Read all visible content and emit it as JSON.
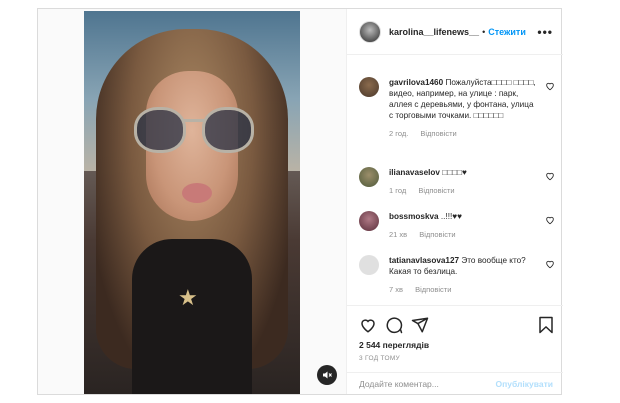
{
  "post": {
    "author": {
      "username": "karolina__lifenews__",
      "follow_label": "Стежити",
      "separator": "•",
      "more_glyph": "•••"
    },
    "comments": [
      {
        "username": "gavrilova1460",
        "text": "Пожалуйста□□□□ □□□□, видео, например, на улице : парк, аллея с деревьями, у фонтана, улица с торговыми точками. □□□□□□",
        "time": "2 год.",
        "reply_label": "Відповісти"
      },
      {
        "username": "ilianavaselov",
        "text": "□□□□♥",
        "time": "1 год",
        "reply_label": "Відповісти"
      },
      {
        "username": "bossmoskva",
        "text": "..!!!♥♥",
        "time": "21 хв",
        "reply_label": "Відповісти"
      },
      {
        "username": "tatianavlasova127",
        "text": "Это вообще кто?Какая то безлица.",
        "time": "7 хв",
        "reply_label": "Відповісти"
      }
    ],
    "views": "2 544 переглядів",
    "posted_ago": "3 год тому",
    "composer": {
      "placeholder": "Додайте коментар...",
      "publish_label": "Опублікувати"
    },
    "icons": [
      "heart-icon",
      "comment-icon",
      "share-icon",
      "bookmark-icon",
      "mute-icon",
      "more-icon"
    ],
    "colors": {
      "link_blue": "#0095f6",
      "publish_disabled": "#b2dffc",
      "secondary_text": "#8e8e8e"
    }
  }
}
